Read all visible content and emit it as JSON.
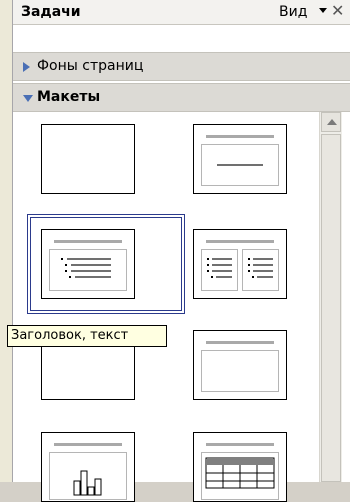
{
  "panel": {
    "title": "Задачи",
    "view_label": "Вид",
    "close_glyph": "✕"
  },
  "sections": {
    "backgrounds": {
      "label": "Фоны страниц",
      "expanded": false
    },
    "layouts": {
      "label": "Макеты",
      "expanded": true
    }
  },
  "layouts": {
    "items": [
      "blank",
      "title-only",
      "title-content",
      "title-two-content",
      "centered-text",
      "title-object",
      "title-chart",
      "title-table"
    ],
    "selected": "title-content"
  },
  "tooltip": {
    "text": "Заголовок, текст"
  },
  "colors": {
    "accent": "#4a6fb5",
    "selection": "#2b3a8c",
    "tooltip_bg": "#ffffe1"
  },
  "icons": {
    "section_collapsed": "triangle-right-icon",
    "section_expanded": "triangle-down-icon",
    "scroll_up": "arrow-up-icon",
    "close": "close-icon",
    "view_dropdown": "chevron-down-icon"
  }
}
